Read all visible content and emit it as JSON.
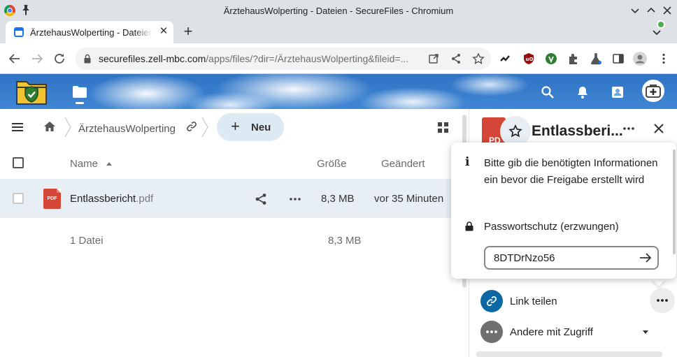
{
  "window": {
    "title": "ÄrztehausWolperting - Dateien - SecureFiles - Chromium"
  },
  "tab": {
    "title": "ÄrztehausWolperting - Dateien - SecureFiles"
  },
  "address": {
    "host": "securefiles.zell-mbc.com",
    "path": "/apps/files/?dir=/ÄrztehausWolperting&fileid=..."
  },
  "breadcrumb": {
    "folder": "ÄrztehausWolperting"
  },
  "toolbar": {
    "new_label": "Neu",
    "new_plus": "+"
  },
  "columns": {
    "name": "Name",
    "size": "Größe",
    "modified": "Geändert"
  },
  "files": [
    {
      "icon_label": "PDF",
      "name": "Entlassbericht",
      "ext": ".pdf",
      "size": "8,3 MB",
      "modified": "vor 35 Minuten"
    }
  ],
  "summary": {
    "count": "1 Datei",
    "size": "8,3 MB"
  },
  "sidebar": {
    "preview_label": "PD",
    "title": "Entlassberi...",
    "link_share_label": "Link teilen",
    "others_label": "Andere mit Zugriff"
  },
  "popover": {
    "info_text": "Bitte gib die benötigten Informationen ein bevor die Freigabe erstellt wird",
    "password_label": "Passwortschutz (erzwungen)",
    "password_value": "8DTDrNzo56"
  },
  "colors": {
    "header_blue": "#2f74c4",
    "row_highlight": "#e7eef4",
    "new_button": "#dcebf3",
    "link_share": "#0b68a5",
    "pdf_red": "#d44638",
    "status_online": "#4caf50"
  },
  "icons": [
    "chromium-icon",
    "pin-icon",
    "tab-favicon",
    "back-icon",
    "forward-icon",
    "reload-icon",
    "lock-icon",
    "open-external-icon",
    "share-icon",
    "star-icon",
    "extension-icons",
    "profile-icon",
    "menu-kebab-icon",
    "files-app-icon",
    "search-icon",
    "bell-icon",
    "contacts-icon",
    "avatar",
    "hamburger-icon",
    "home-icon",
    "link-icon",
    "grid-view-icon",
    "sort-ascending-icon",
    "pdf-icon",
    "more-icon",
    "close-icon",
    "info-icon",
    "arrow-right-icon",
    "chevron-down-icon"
  ]
}
